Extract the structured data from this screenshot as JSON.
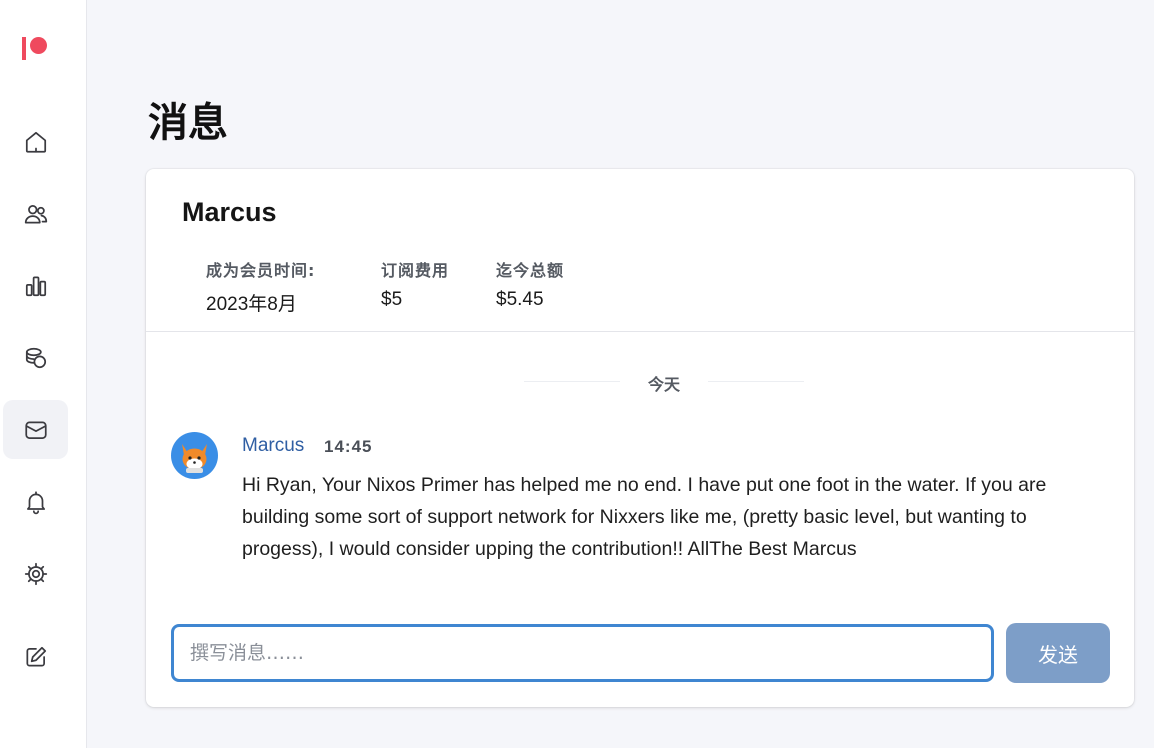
{
  "app": {
    "brand_color": "#ef4a5e",
    "accent": "#3f86d1"
  },
  "sidebar": {
    "items": [
      {
        "name": "home",
        "icon": "home-icon"
      },
      {
        "name": "members",
        "icon": "users-icon"
      },
      {
        "name": "stats",
        "icon": "bar-chart-icon"
      },
      {
        "name": "payouts",
        "icon": "coins-icon"
      },
      {
        "name": "messages",
        "icon": "mail-icon",
        "active": true
      },
      {
        "name": "notifications",
        "icon": "bell-icon"
      },
      {
        "name": "settings",
        "icon": "gear-icon"
      },
      {
        "name": "create",
        "icon": "edit-icon"
      }
    ]
  },
  "page": {
    "title": "消息"
  },
  "member": {
    "name": "Marcus",
    "stats": [
      {
        "label": "成为会员时间:",
        "value": "2023年8月"
      },
      {
        "label": "订阅费用",
        "value": "$5"
      },
      {
        "label": "迄今总额",
        "value": "$5.45"
      }
    ]
  },
  "conversation": {
    "day_label": "今天",
    "messages": [
      {
        "author": "Marcus",
        "time": "14:45",
        "avatar": "fox-avatar",
        "body": "Hi Ryan, Your Nixos Primer has helped me no end. I have put one foot in the water. If you are building some sort of support network for Nixxers like me, (pretty basic level, but wanting to progess), I would consider upping the contribution!! AllThe Best Marcus"
      }
    ]
  },
  "composer": {
    "placeholder": "撰写消息……",
    "value": "",
    "send_label": "发送"
  }
}
